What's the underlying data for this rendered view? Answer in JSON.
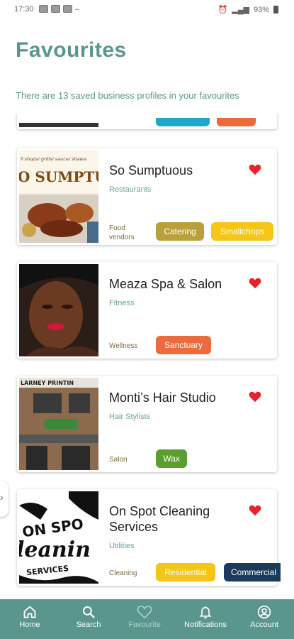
{
  "status_bar": {
    "time": "17:30",
    "battery": "93%"
  },
  "header": {
    "title": "Favourites",
    "subtitle": "There are 13 saved business profiles in your favourites"
  },
  "cards": [
    {
      "name": "So Sumptuous",
      "category": "Restaurants",
      "sub_category": "Food vendors",
      "tags": [
        {
          "label": "Catering",
          "color": "#b9a03a"
        },
        {
          "label": "Smallchops",
          "color": "#f5c518"
        }
      ],
      "image_text": [
        "ll shops/ grills/ sauce/ shawa",
        "O SUMPTUOU"
      ]
    },
    {
      "name": "Meaza Spa & Salon",
      "category": "Fitness",
      "sub_category": "Wellness",
      "tags": [
        {
          "label": "Sanctuary",
          "color": "#ec6b3e"
        }
      ]
    },
    {
      "name": "Monti’s Hair Studio",
      "category": "Hair Stylists",
      "sub_category": "Salon",
      "tags": [
        {
          "label": "Wax",
          "color": "#5a9e2f"
        }
      ],
      "image_text": [
        "LARNEY PRINTIN"
      ]
    },
    {
      "name_line1": "On Spot Cleaning",
      "name_line2": "Services",
      "category": "Utilities",
      "sub_category": "Cleaning",
      "tags": [
        {
          "label": "Residential",
          "color": "#f5c518"
        },
        {
          "label": "Commercial",
          "color": "#1b3a5c"
        }
      ],
      "image_text": [
        "ON SPO",
        "leanin",
        "SERVICES"
      ]
    }
  ],
  "nav": [
    {
      "label": "Home",
      "icon": "home-icon"
    },
    {
      "label": "Search",
      "icon": "search-icon"
    },
    {
      "label": "Favourite",
      "icon": "heart-outline-icon",
      "active": true
    },
    {
      "label": "Notifications",
      "icon": "bell-icon"
    },
    {
      "label": "Account",
      "icon": "account-icon"
    }
  ],
  "colors": {
    "accent": "#5a968c",
    "heart": "#e8212b"
  }
}
